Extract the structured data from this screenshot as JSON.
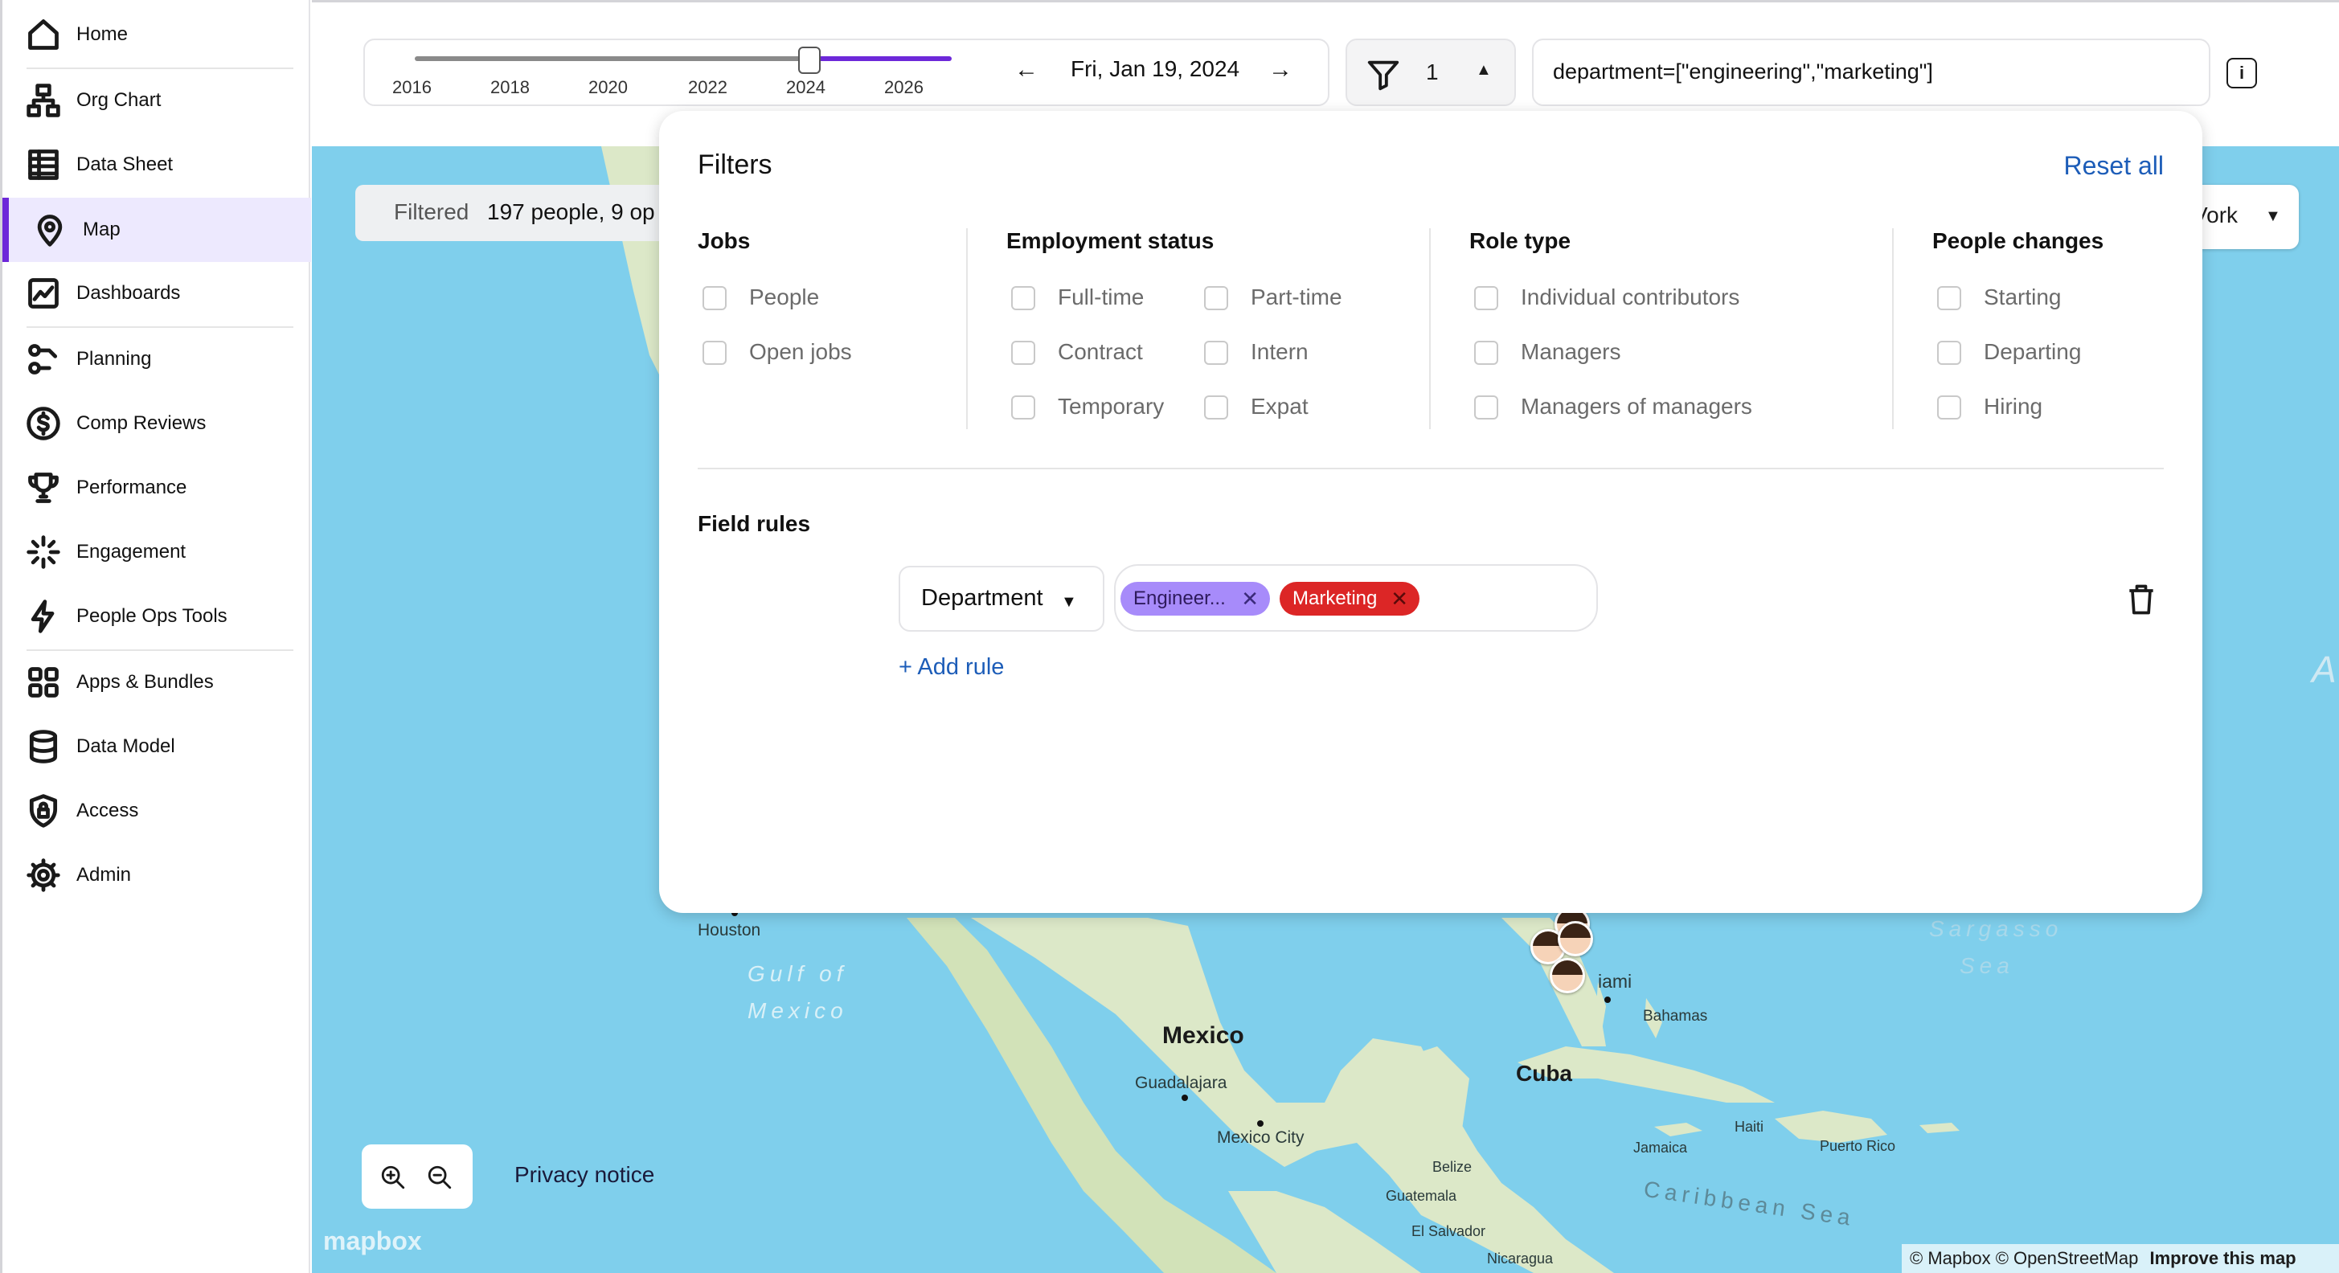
{
  "sidebar": {
    "items": [
      {
        "label": "Home",
        "icon": "home-icon"
      },
      {
        "label": "Org Chart",
        "icon": "org-chart-icon"
      },
      {
        "label": "Data Sheet",
        "icon": "table-icon"
      },
      {
        "label": "Map",
        "icon": "map-pin-icon",
        "active": true
      },
      {
        "label": "Dashboards",
        "icon": "chart-icon"
      },
      {
        "label": "Planning",
        "icon": "planning-icon"
      },
      {
        "label": "Comp Reviews",
        "icon": "dollar-icon"
      },
      {
        "label": "Performance",
        "icon": "trophy-icon"
      },
      {
        "label": "Engagement",
        "icon": "sparkle-icon"
      },
      {
        "label": "People Ops Tools",
        "icon": "bolt-icon"
      },
      {
        "label": "Apps & Bundles",
        "icon": "grid-icon"
      },
      {
        "label": "Data Model",
        "icon": "database-icon"
      },
      {
        "label": "Access",
        "icon": "shield-icon"
      },
      {
        "label": "Admin",
        "icon": "gear-icon"
      }
    ]
  },
  "timeline": {
    "years": [
      "2016",
      "2018",
      "2020",
      "2022",
      "2024",
      "2026"
    ],
    "current_date": "Fri, Jan 19, 2024",
    "prev_symbol": "←",
    "next_symbol": "→"
  },
  "filter_toggle": {
    "count": "1",
    "caret": "▲"
  },
  "query": {
    "text": "department=[\"engineering\",\"marketing\"]"
  },
  "info_button": {
    "label": "i"
  },
  "summary": {
    "label": "Filtered",
    "text": "197 people, 9 op"
  },
  "group_select": {
    "label": "Vork",
    "caret": "▼"
  },
  "filters": {
    "title": "Filters",
    "reset_label": "Reset all",
    "jobs": {
      "title": "Jobs",
      "options": [
        "People",
        "Open jobs"
      ]
    },
    "employment_status": {
      "title": "Employment status",
      "col1": [
        "Full-time",
        "Contract",
        "Temporary"
      ],
      "col2": [
        "Part-time",
        "Intern",
        "Expat"
      ]
    },
    "role_type": {
      "title": "Role type",
      "options": [
        "Individual contributors",
        "Managers",
        "Managers of managers"
      ]
    },
    "people_changes": {
      "title": "People changes",
      "options": [
        "Starting",
        "Departing",
        "Hiring"
      ]
    },
    "field_rules": {
      "title": "Field rules",
      "field": "Department",
      "caret": "▼",
      "values": [
        {
          "label": "Engineer...",
          "color": "#a78bfa"
        },
        {
          "label": "Marketing",
          "color": "#dc2626"
        }
      ],
      "remove_symbol": "✕",
      "add_rule_label": "+ Add rule"
    }
  },
  "map": {
    "labels": {
      "houston": "Houston",
      "gulf1": "Gulf of",
      "gulf2": "Mexico",
      "sargasso1": "Sargasso",
      "sargasso2": "Sea",
      "miami": "iami",
      "bahamas": "Bahamas",
      "mexico": "Mexico",
      "guadalajara": "Guadalajara",
      "mexico_city": "Mexico City",
      "cuba": "Cuba",
      "haiti": "Haiti",
      "jamaica": "Jamaica",
      "puerto_rico": "Puerto Rico",
      "belize": "Belize",
      "guatemala": "Guatemala",
      "el_salvador": "El Salvador",
      "nicaragua": "Nicaragua",
      "caribbean": "Caribbean Sea",
      "edge": "A"
    },
    "privacy_label": "Privacy notice",
    "logo_text": "mapbox",
    "attribution": "© Mapbox © OpenStreetMap",
    "improve_label": "Improve this map",
    "colors": {
      "water": "#7fcfec",
      "land": "#dce8c8",
      "accent": "#6d28d9"
    }
  }
}
